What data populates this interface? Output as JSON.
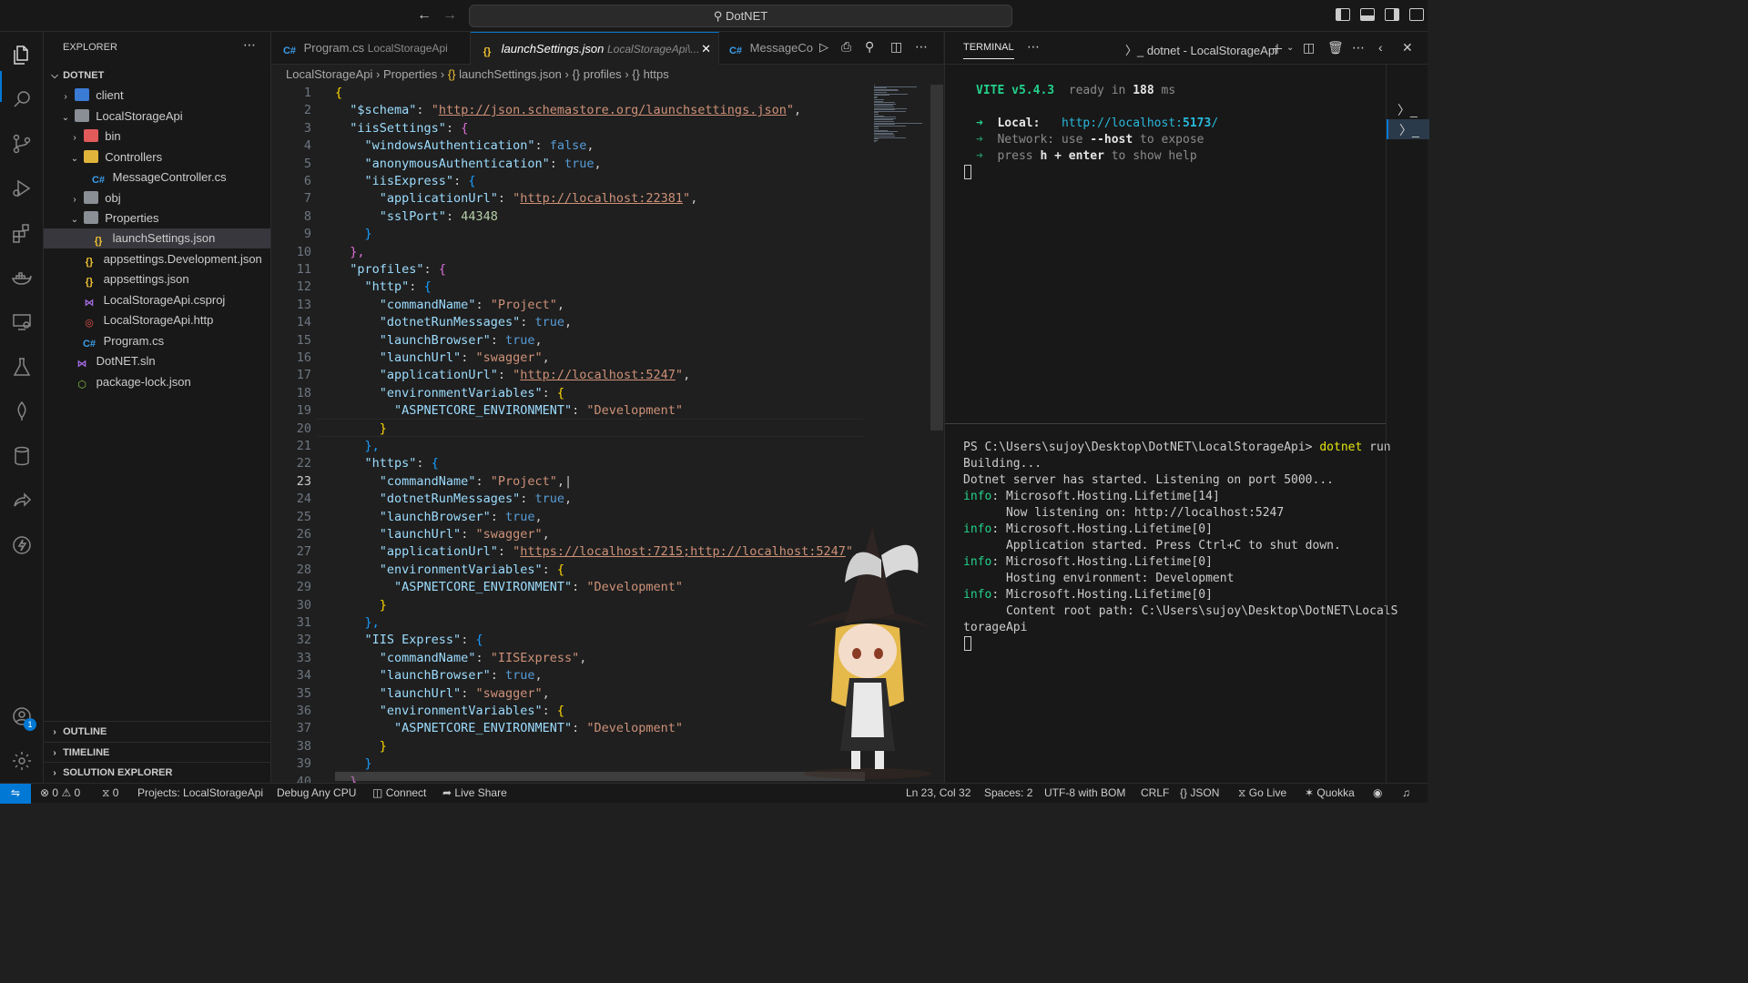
{
  "title": {
    "search": "DotNET"
  },
  "sidebar": {
    "title": "EXPLORER",
    "root": "DOTNET",
    "items": [
      {
        "label": "client"
      },
      {
        "label": "LocalStorageApi"
      },
      {
        "label": "bin"
      },
      {
        "label": "Controllers"
      },
      {
        "label": "MessageController.cs"
      },
      {
        "label": "obj"
      },
      {
        "label": "Properties"
      },
      {
        "label": "launchSettings.json"
      },
      {
        "label": "appsettings.Development.json"
      },
      {
        "label": "appsettings.json"
      },
      {
        "label": "LocalStorageApi.csproj"
      },
      {
        "label": "LocalStorageApi.http"
      },
      {
        "label": "Program.cs"
      },
      {
        "label": "DotNET.sln"
      },
      {
        "label": "package-lock.json"
      }
    ],
    "sections": [
      "OUTLINE",
      "TIMELINE",
      "SOLUTION EXPLORER"
    ]
  },
  "tabs": [
    {
      "label": "Program.cs",
      "desc": "LocalStorageApi"
    },
    {
      "label": "launchSettings.json",
      "desc": "LocalStorageApi\\..."
    },
    {
      "label": "MessageCo"
    }
  ],
  "breadcrumb": [
    "LocalStorageApi",
    "Properties",
    "launchSettings.json",
    "profiles",
    "https"
  ],
  "editor": {
    "current_line": 23,
    "lines": [
      [
        [
          "br1",
          "{"
        ]
      ],
      [
        [
          "p",
          "  "
        ],
        [
          "k",
          "\"$schema\""
        ],
        [
          "p",
          ": "
        ],
        [
          "s",
          "\""
        ],
        [
          "su",
          "http://json.schemastore.org/launchsettings.json"
        ],
        [
          "s",
          "\""
        ],
        [
          "p",
          ","
        ]
      ],
      [
        [
          "p",
          "  "
        ],
        [
          "k",
          "\"iisSettings\""
        ],
        [
          "p",
          ": "
        ],
        [
          "br2",
          "{"
        ]
      ],
      [
        [
          "p",
          "    "
        ],
        [
          "k",
          "\"windowsAuthentication\""
        ],
        [
          "p",
          ": "
        ],
        [
          "b",
          "false"
        ],
        [
          "p",
          ","
        ]
      ],
      [
        [
          "p",
          "    "
        ],
        [
          "k",
          "\"anonymousAuthentication\""
        ],
        [
          "p",
          ": "
        ],
        [
          "b",
          "true"
        ],
        [
          "p",
          ","
        ]
      ],
      [
        [
          "p",
          "    "
        ],
        [
          "k",
          "\"iisExpress\""
        ],
        [
          "p",
          ": "
        ],
        [
          "br3",
          "{"
        ]
      ],
      [
        [
          "p",
          "      "
        ],
        [
          "k",
          "\"applicationUrl\""
        ],
        [
          "p",
          ": "
        ],
        [
          "s",
          "\""
        ],
        [
          "su",
          "http://localhost:22381"
        ],
        [
          "s",
          "\""
        ],
        [
          "p",
          ","
        ]
      ],
      [
        [
          "p",
          "      "
        ],
        [
          "k",
          "\"sslPort\""
        ],
        [
          "p",
          ": "
        ],
        [
          "n",
          "44348"
        ]
      ],
      [
        [
          "p",
          "    "
        ],
        [
          "br3",
          "}"
        ]
      ],
      [
        [
          "p",
          "  "
        ],
        [
          "br2",
          "},"
        ]
      ],
      [
        [
          "p",
          "  "
        ],
        [
          "k",
          "\"profiles\""
        ],
        [
          "p",
          ": "
        ],
        [
          "br2",
          "{"
        ]
      ],
      [
        [
          "p",
          "    "
        ],
        [
          "k",
          "\"http\""
        ],
        [
          "p",
          ": "
        ],
        [
          "br3",
          "{"
        ]
      ],
      [
        [
          "p",
          "      "
        ],
        [
          "k",
          "\"commandName\""
        ],
        [
          "p",
          ": "
        ],
        [
          "s",
          "\"Project\""
        ],
        [
          "p",
          ","
        ]
      ],
      [
        [
          "p",
          "      "
        ],
        [
          "k",
          "\"dotnetRunMessages\""
        ],
        [
          "p",
          ": "
        ],
        [
          "b",
          "true"
        ],
        [
          "p",
          ","
        ]
      ],
      [
        [
          "p",
          "      "
        ],
        [
          "k",
          "\"launchBrowser\""
        ],
        [
          "p",
          ": "
        ],
        [
          "b",
          "true"
        ],
        [
          "p",
          ","
        ]
      ],
      [
        [
          "p",
          "      "
        ],
        [
          "k",
          "\"launchUrl\""
        ],
        [
          "p",
          ": "
        ],
        [
          "s",
          "\"swagger\""
        ],
        [
          "p",
          ","
        ]
      ],
      [
        [
          "p",
          "      "
        ],
        [
          "k",
          "\"applicationUrl\""
        ],
        [
          "p",
          ": "
        ],
        [
          "s",
          "\""
        ],
        [
          "su",
          "http://localhost:5247"
        ],
        [
          "s",
          "\""
        ],
        [
          "p",
          ","
        ]
      ],
      [
        [
          "p",
          "      "
        ],
        [
          "k",
          "\"environmentVariables\""
        ],
        [
          "p",
          ": "
        ],
        [
          "br1",
          "{"
        ]
      ],
      [
        [
          "p",
          "        "
        ],
        [
          "k",
          "\"ASPNETCORE_ENVIRONMENT\""
        ],
        [
          "p",
          ": "
        ],
        [
          "s",
          "\"Development\""
        ]
      ],
      [
        [
          "p",
          "      "
        ],
        [
          "br1",
          "}"
        ]
      ],
      [
        [
          "p",
          "    "
        ],
        [
          "br3",
          "},"
        ]
      ],
      [
        [
          "p",
          "    "
        ],
        [
          "k",
          "\"https\""
        ],
        [
          "p",
          ": "
        ],
        [
          "br3",
          "{"
        ]
      ],
      [
        [
          "p",
          "      "
        ],
        [
          "k",
          "\"commandName\""
        ],
        [
          "p",
          ": "
        ],
        [
          "s",
          "\"Project\""
        ],
        [
          "p",
          ",|"
        ]
      ],
      [
        [
          "p",
          "      "
        ],
        [
          "k",
          "\"dotnetRunMessages\""
        ],
        [
          "p",
          ": "
        ],
        [
          "b",
          "true"
        ],
        [
          "p",
          ","
        ]
      ],
      [
        [
          "p",
          "      "
        ],
        [
          "k",
          "\"launchBrowser\""
        ],
        [
          "p",
          ": "
        ],
        [
          "b",
          "true"
        ],
        [
          "p",
          ","
        ]
      ],
      [
        [
          "p",
          "      "
        ],
        [
          "k",
          "\"launchUrl\""
        ],
        [
          "p",
          ": "
        ],
        [
          "s",
          "\"swagger\""
        ],
        [
          "p",
          ","
        ]
      ],
      [
        [
          "p",
          "      "
        ],
        [
          "k",
          "\"applicationUrl\""
        ],
        [
          "p",
          ": "
        ],
        [
          "s",
          "\""
        ],
        [
          "su",
          "https://localhost:7215;http://localhost:5247"
        ],
        [
          "s",
          "\""
        ],
        [
          "p",
          ","
        ]
      ],
      [
        [
          "p",
          "      "
        ],
        [
          "k",
          "\"environmentVariables\""
        ],
        [
          "p",
          ": "
        ],
        [
          "br1",
          "{"
        ]
      ],
      [
        [
          "p",
          "        "
        ],
        [
          "k",
          "\"ASPNETCORE_ENVIRONMENT\""
        ],
        [
          "p",
          ": "
        ],
        [
          "s",
          "\"Development\""
        ]
      ],
      [
        [
          "p",
          "      "
        ],
        [
          "br1",
          "}"
        ]
      ],
      [
        [
          "p",
          "    "
        ],
        [
          "br3",
          "},"
        ]
      ],
      [
        [
          "p",
          "    "
        ],
        [
          "k",
          "\"IIS Express\""
        ],
        [
          "p",
          ": "
        ],
        [
          "br3",
          "{"
        ]
      ],
      [
        [
          "p",
          "      "
        ],
        [
          "k",
          "\"commandName\""
        ],
        [
          "p",
          ": "
        ],
        [
          "s",
          "\"IISExpress\""
        ],
        [
          "p",
          ","
        ]
      ],
      [
        [
          "p",
          "      "
        ],
        [
          "k",
          "\"launchBrowser\""
        ],
        [
          "p",
          ": "
        ],
        [
          "b",
          "true"
        ],
        [
          "p",
          ","
        ]
      ],
      [
        [
          "p",
          "      "
        ],
        [
          "k",
          "\"launchUrl\""
        ],
        [
          "p",
          ": "
        ],
        [
          "s",
          "\"swagger\""
        ],
        [
          "p",
          ","
        ]
      ],
      [
        [
          "p",
          "      "
        ],
        [
          "k",
          "\"environmentVariables\""
        ],
        [
          "p",
          ": "
        ],
        [
          "br1",
          "{"
        ]
      ],
      [
        [
          "p",
          "        "
        ],
        [
          "k",
          "\"ASPNETCORE_ENVIRONMENT\""
        ],
        [
          "p",
          ": "
        ],
        [
          "s",
          "\"Development\""
        ]
      ],
      [
        [
          "p",
          "      "
        ],
        [
          "br1",
          "}"
        ]
      ],
      [
        [
          "p",
          "    "
        ],
        [
          "br3",
          "}"
        ]
      ],
      [
        [
          "p",
          "  "
        ],
        [
          "br2",
          "}"
        ]
      ]
    ]
  },
  "terminal": {
    "tab": "TERMINAL",
    "name": "dotnet - LocalStorageApi",
    "vite": [
      [
        [
          "g",
          "VITE v5.4.3"
        ],
        [
          "d",
          "  ready in "
        ],
        [
          "w",
          "188"
        ],
        [
          "d",
          " ms"
        ]
      ],
      [
        [
          "p",
          ""
        ]
      ],
      [
        [
          "g",
          "➜  "
        ],
        [
          "w",
          "Local:   "
        ],
        [
          "c",
          "http://localhost:"
        ],
        [
          "cb",
          "5173"
        ],
        [
          "c",
          "/"
        ]
      ],
      [
        [
          "g2",
          "➜  "
        ],
        [
          "d",
          "Network: use "
        ],
        [
          "w",
          "--host"
        ],
        [
          "d",
          " to expose"
        ]
      ],
      [
        [
          "g2",
          "➜  "
        ],
        [
          "d",
          "press "
        ],
        [
          "w",
          "h + enter"
        ],
        [
          "d",
          " to show help"
        ]
      ]
    ],
    "dotnet": [
      [
        [
          "p",
          "PS C:\\Users\\sujoy\\Desktop\\DotNET\\LocalStorageApi> "
        ],
        [
          "y",
          "dotnet"
        ],
        [
          "p",
          " run"
        ]
      ],
      [
        [
          "p",
          "Building..."
        ]
      ],
      [
        [
          "p",
          "Dotnet server has started. Listening on port 5000..."
        ]
      ],
      [
        [
          "i",
          "info"
        ],
        [
          "p",
          ": Microsoft.Hosting.Lifetime[14]"
        ]
      ],
      [
        [
          "p",
          "      Now listening on: http://localhost:5247"
        ]
      ],
      [
        [
          "i",
          "info"
        ],
        [
          "p",
          ": Microsoft.Hosting.Lifetime[0]"
        ]
      ],
      [
        [
          "p",
          "      Application started. Press Ctrl+C to shut down."
        ]
      ],
      [
        [
          "i",
          "info"
        ],
        [
          "p",
          ": Microsoft.Hosting.Lifetime[0]"
        ]
      ],
      [
        [
          "p",
          "      Hosting environment: Development"
        ]
      ],
      [
        [
          "i",
          "info"
        ],
        [
          "p",
          ": Microsoft.Hosting.Lifetime[0]"
        ]
      ],
      [
        [
          "p",
          "      Content root path: C:\\Users\\sujoy\\Desktop\\DotNET\\LocalS"
        ]
      ],
      [
        [
          "p",
          "torageApi"
        ]
      ]
    ]
  },
  "status": {
    "errors": "0",
    "warnings": "0",
    "ports": "0",
    "projects": "Projects: LocalStorageApi",
    "debug": "Debug Any CPU",
    "connect": "Connect",
    "liveshare": "Live Share",
    "position": "Ln 23, Col 32",
    "spaces": "Spaces: 2",
    "encoding": "UTF-8 with BOM",
    "eol": "CRLF",
    "language": "JSON",
    "golive": "Go Live",
    "quokka": "Quokka",
    "account_badge": "1"
  },
  "colors": {
    "accent": "#0078d4",
    "bg": "#1f1f1f",
    "sidebar": "#181818"
  }
}
